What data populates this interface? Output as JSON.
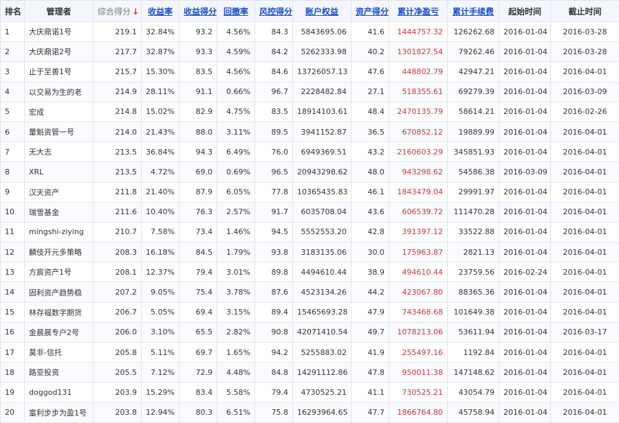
{
  "header": {
    "rank": "排名",
    "manager": "管理者",
    "score": "综合得分",
    "score_arrow": "↓",
    "return_rate": "收益率",
    "return_score": "收益得分",
    "drawdown": "回撤率",
    "risk_score": "风控得分",
    "equity": "账户权益",
    "asset_score": "资产得分",
    "cum_pnl": "累计净盈亏",
    "cum_fee": "累计手续费",
    "start": "起始时间",
    "end": "截止时间"
  },
  "rows": [
    {
      "rank": "1",
      "manager": "大庆鼎诺1号",
      "score": "219.1",
      "return_rate": "32.84%",
      "return_score": "93.2",
      "drawdown": "4.56%",
      "risk_score": "84.3",
      "equity": "5843695.06",
      "asset_score": "41.6",
      "cum_pnl": "1444757.32",
      "cum_fee": "126262.68",
      "start": "2016-01-04",
      "end": "2016-03-28"
    },
    {
      "rank": "2",
      "manager": "大庆鼎诺2号",
      "score": "217.7",
      "return_rate": "32.87%",
      "return_score": "93.3",
      "drawdown": "4.59%",
      "risk_score": "84.2",
      "equity": "5262333.98",
      "asset_score": "40.2",
      "cum_pnl": "1301827.54",
      "cum_fee": "79262.46",
      "start": "2016-01-04",
      "end": "2016-03-28"
    },
    {
      "rank": "3",
      "manager": "止于至善1号",
      "score": "215.7",
      "return_rate": "15.30%",
      "return_score": "83.5",
      "drawdown": "4.56%",
      "risk_score": "84.6",
      "equity": "13726057.13",
      "asset_score": "47.6",
      "cum_pnl": "448802.79",
      "cum_fee": "42947.21",
      "start": "2016-01-04",
      "end": "2016-04-01"
    },
    {
      "rank": "4",
      "manager": "以交易为生的老",
      "score": "214.9",
      "return_rate": "28.11%",
      "return_score": "91.1",
      "drawdown": "0.66%",
      "risk_score": "96.7",
      "equity": "2228482.84",
      "asset_score": "27.1",
      "cum_pnl": "518355.61",
      "cum_fee": "69279.39",
      "start": "2016-01-04",
      "end": "2016-03-09"
    },
    {
      "rank": "5",
      "manager": "宏成",
      "score": "214.8",
      "return_rate": "15.02%",
      "return_score": "82.9",
      "drawdown": "4.75%",
      "risk_score": "83.5",
      "equity": "18914103.61",
      "asset_score": "48.4",
      "cum_pnl": "2470135.79",
      "cum_fee": "58614.21",
      "start": "2016-01-04",
      "end": "2016-02-26"
    },
    {
      "rank": "6",
      "manager": "量魁资管一号",
      "score": "214.0",
      "return_rate": "21.43%",
      "return_score": "88.0",
      "drawdown": "3.11%",
      "risk_score": "89.5",
      "equity": "3941152.87",
      "asset_score": "36.5",
      "cum_pnl": "670852.12",
      "cum_fee": "19889.99",
      "start": "2016-01-04",
      "end": "2016-04-01"
    },
    {
      "rank": "7",
      "manager": "无大志",
      "score": "213.5",
      "return_rate": "36.84%",
      "return_score": "94.3",
      "drawdown": "6.49%",
      "risk_score": "76.0",
      "equity": "6949369.51",
      "asset_score": "43.2",
      "cum_pnl": "2160603.29",
      "cum_fee": "345851.93",
      "start": "2016-01-04",
      "end": "2016-04-01"
    },
    {
      "rank": "8",
      "manager": "XRL",
      "score": "213.5",
      "return_rate": "4.72%",
      "return_score": "69.0",
      "drawdown": "0.69%",
      "risk_score": "96.5",
      "equity": "20943298.62",
      "asset_score": "48.0",
      "cum_pnl": "943298.62",
      "cum_fee": "54586.38",
      "start": "2016-03-09",
      "end": "2016-04-01"
    },
    {
      "rank": "9",
      "manager": "汉天资产",
      "score": "211.8",
      "return_rate": "21.40%",
      "return_score": "87.9",
      "drawdown": "6.05%",
      "risk_score": "77.8",
      "equity": "10365435.83",
      "asset_score": "46.1",
      "cum_pnl": "1843479.04",
      "cum_fee": "29991.97",
      "start": "2016-01-04",
      "end": "2016-04-01"
    },
    {
      "rank": "10",
      "manager": "瑞雪基金",
      "score": "211.6",
      "return_rate": "10.40%",
      "return_score": "76.3",
      "drawdown": "2.57%",
      "risk_score": "91.7",
      "equity": "6035708.04",
      "asset_score": "43.6",
      "cum_pnl": "606539.72",
      "cum_fee": "111470.28",
      "start": "2016-01-04",
      "end": "2016-04-01"
    },
    {
      "rank": "11",
      "manager": "mingshi-ziying",
      "score": "210.7",
      "return_rate": "7.58%",
      "return_score": "73.4",
      "drawdown": "1.46%",
      "risk_score": "94.5",
      "equity": "5552553.20",
      "asset_score": "42.8",
      "cum_pnl": "391397.12",
      "cum_fee": "33522.88",
      "start": "2016-01-04",
      "end": "2016-04-01"
    },
    {
      "rank": "12",
      "manager": "麟伎开元多策略",
      "score": "208.3",
      "return_rate": "16.18%",
      "return_score": "84.5",
      "drawdown": "1.79%",
      "risk_score": "93.8",
      "equity": "3183135.06",
      "asset_score": "30.0",
      "cum_pnl": "175963.87",
      "cum_fee": "2821.13",
      "start": "2016-01-04",
      "end": "2016-04-01"
    },
    {
      "rank": "13",
      "manager": "方宸资产1号",
      "score": "208.1",
      "return_rate": "12.37%",
      "return_score": "79.4",
      "drawdown": "3.01%",
      "risk_score": "89.8",
      "equity": "4494610.44",
      "asset_score": "38.9",
      "cum_pnl": "494610.44",
      "cum_fee": "23759.56",
      "start": "2016-02-24",
      "end": "2016-04-01"
    },
    {
      "rank": "14",
      "manager": "固利资产趋势稳",
      "score": "207.2",
      "return_rate": "9.05%",
      "return_score": "75.4",
      "drawdown": "3.78%",
      "risk_score": "87.6",
      "equity": "4523134.26",
      "asset_score": "44.2",
      "cum_pnl": "423067.80",
      "cum_fee": "88365.36",
      "start": "2016-01-04",
      "end": "2016-04-01"
    },
    {
      "rank": "15",
      "manager": "林存福数字期货",
      "score": "206.7",
      "return_rate": "5.05%",
      "return_score": "69.4",
      "drawdown": "3.15%",
      "risk_score": "89.4",
      "equity": "15465693.28",
      "asset_score": "47.9",
      "cum_pnl": "743468.68",
      "cum_fee": "101649.38",
      "start": "2016-01-04",
      "end": "2016-04-01"
    },
    {
      "rank": "16",
      "manager": "金晨晨专户2号",
      "score": "206.0",
      "return_rate": "3.10%",
      "return_score": "65.5",
      "drawdown": "2.82%",
      "risk_score": "90.8",
      "equity": "42071410.54",
      "asset_score": "49.7",
      "cum_pnl": "1078213.06",
      "cum_fee": "53611.94",
      "start": "2016-01-04",
      "end": "2016-03-17"
    },
    {
      "rank": "17",
      "manager": "莫非-信托",
      "score": "205.8",
      "return_rate": "5.11%",
      "return_score": "69.7",
      "drawdown": "1.65%",
      "risk_score": "94.2",
      "equity": "5255883.02",
      "asset_score": "41.9",
      "cum_pnl": "255497.16",
      "cum_fee": "1192.84",
      "start": "2016-01-04",
      "end": "2016-04-01"
    },
    {
      "rank": "18",
      "manager": "路亚投资",
      "score": "205.5",
      "return_rate": "7.12%",
      "return_score": "72.9",
      "drawdown": "4.48%",
      "risk_score": "84.8",
      "equity": "14291112.86",
      "asset_score": "47.8",
      "cum_pnl": "950011.38",
      "cum_fee": "147148.62",
      "start": "2016-01-04",
      "end": "2016-04-01"
    },
    {
      "rank": "19",
      "manager": "doggod131",
      "score": "203.9",
      "return_rate": "15.29%",
      "return_score": "83.4",
      "drawdown": "5.58%",
      "risk_score": "79.4",
      "equity": "4730525.21",
      "asset_score": "41.1",
      "cum_pnl": "730525.21",
      "cum_fee": "43054.79",
      "start": "2016-01-04",
      "end": "2016-04-01"
    },
    {
      "rank": "20",
      "manager": "富利步步为盈1号",
      "score": "203.8",
      "return_rate": "12.94%",
      "return_score": "80.3",
      "drawdown": "6.51%",
      "risk_score": "75.8",
      "equity": "16293964.65",
      "asset_score": "47.7",
      "cum_pnl": "1866764.80",
      "cum_fee": "45758.94",
      "start": "2016-01-04",
      "end": "2016-04-01"
    }
  ],
  "colors": {
    "pnl": "#d8323c",
    "link": "#1a4fcf",
    "sort_arrow": "#e0292b"
  }
}
